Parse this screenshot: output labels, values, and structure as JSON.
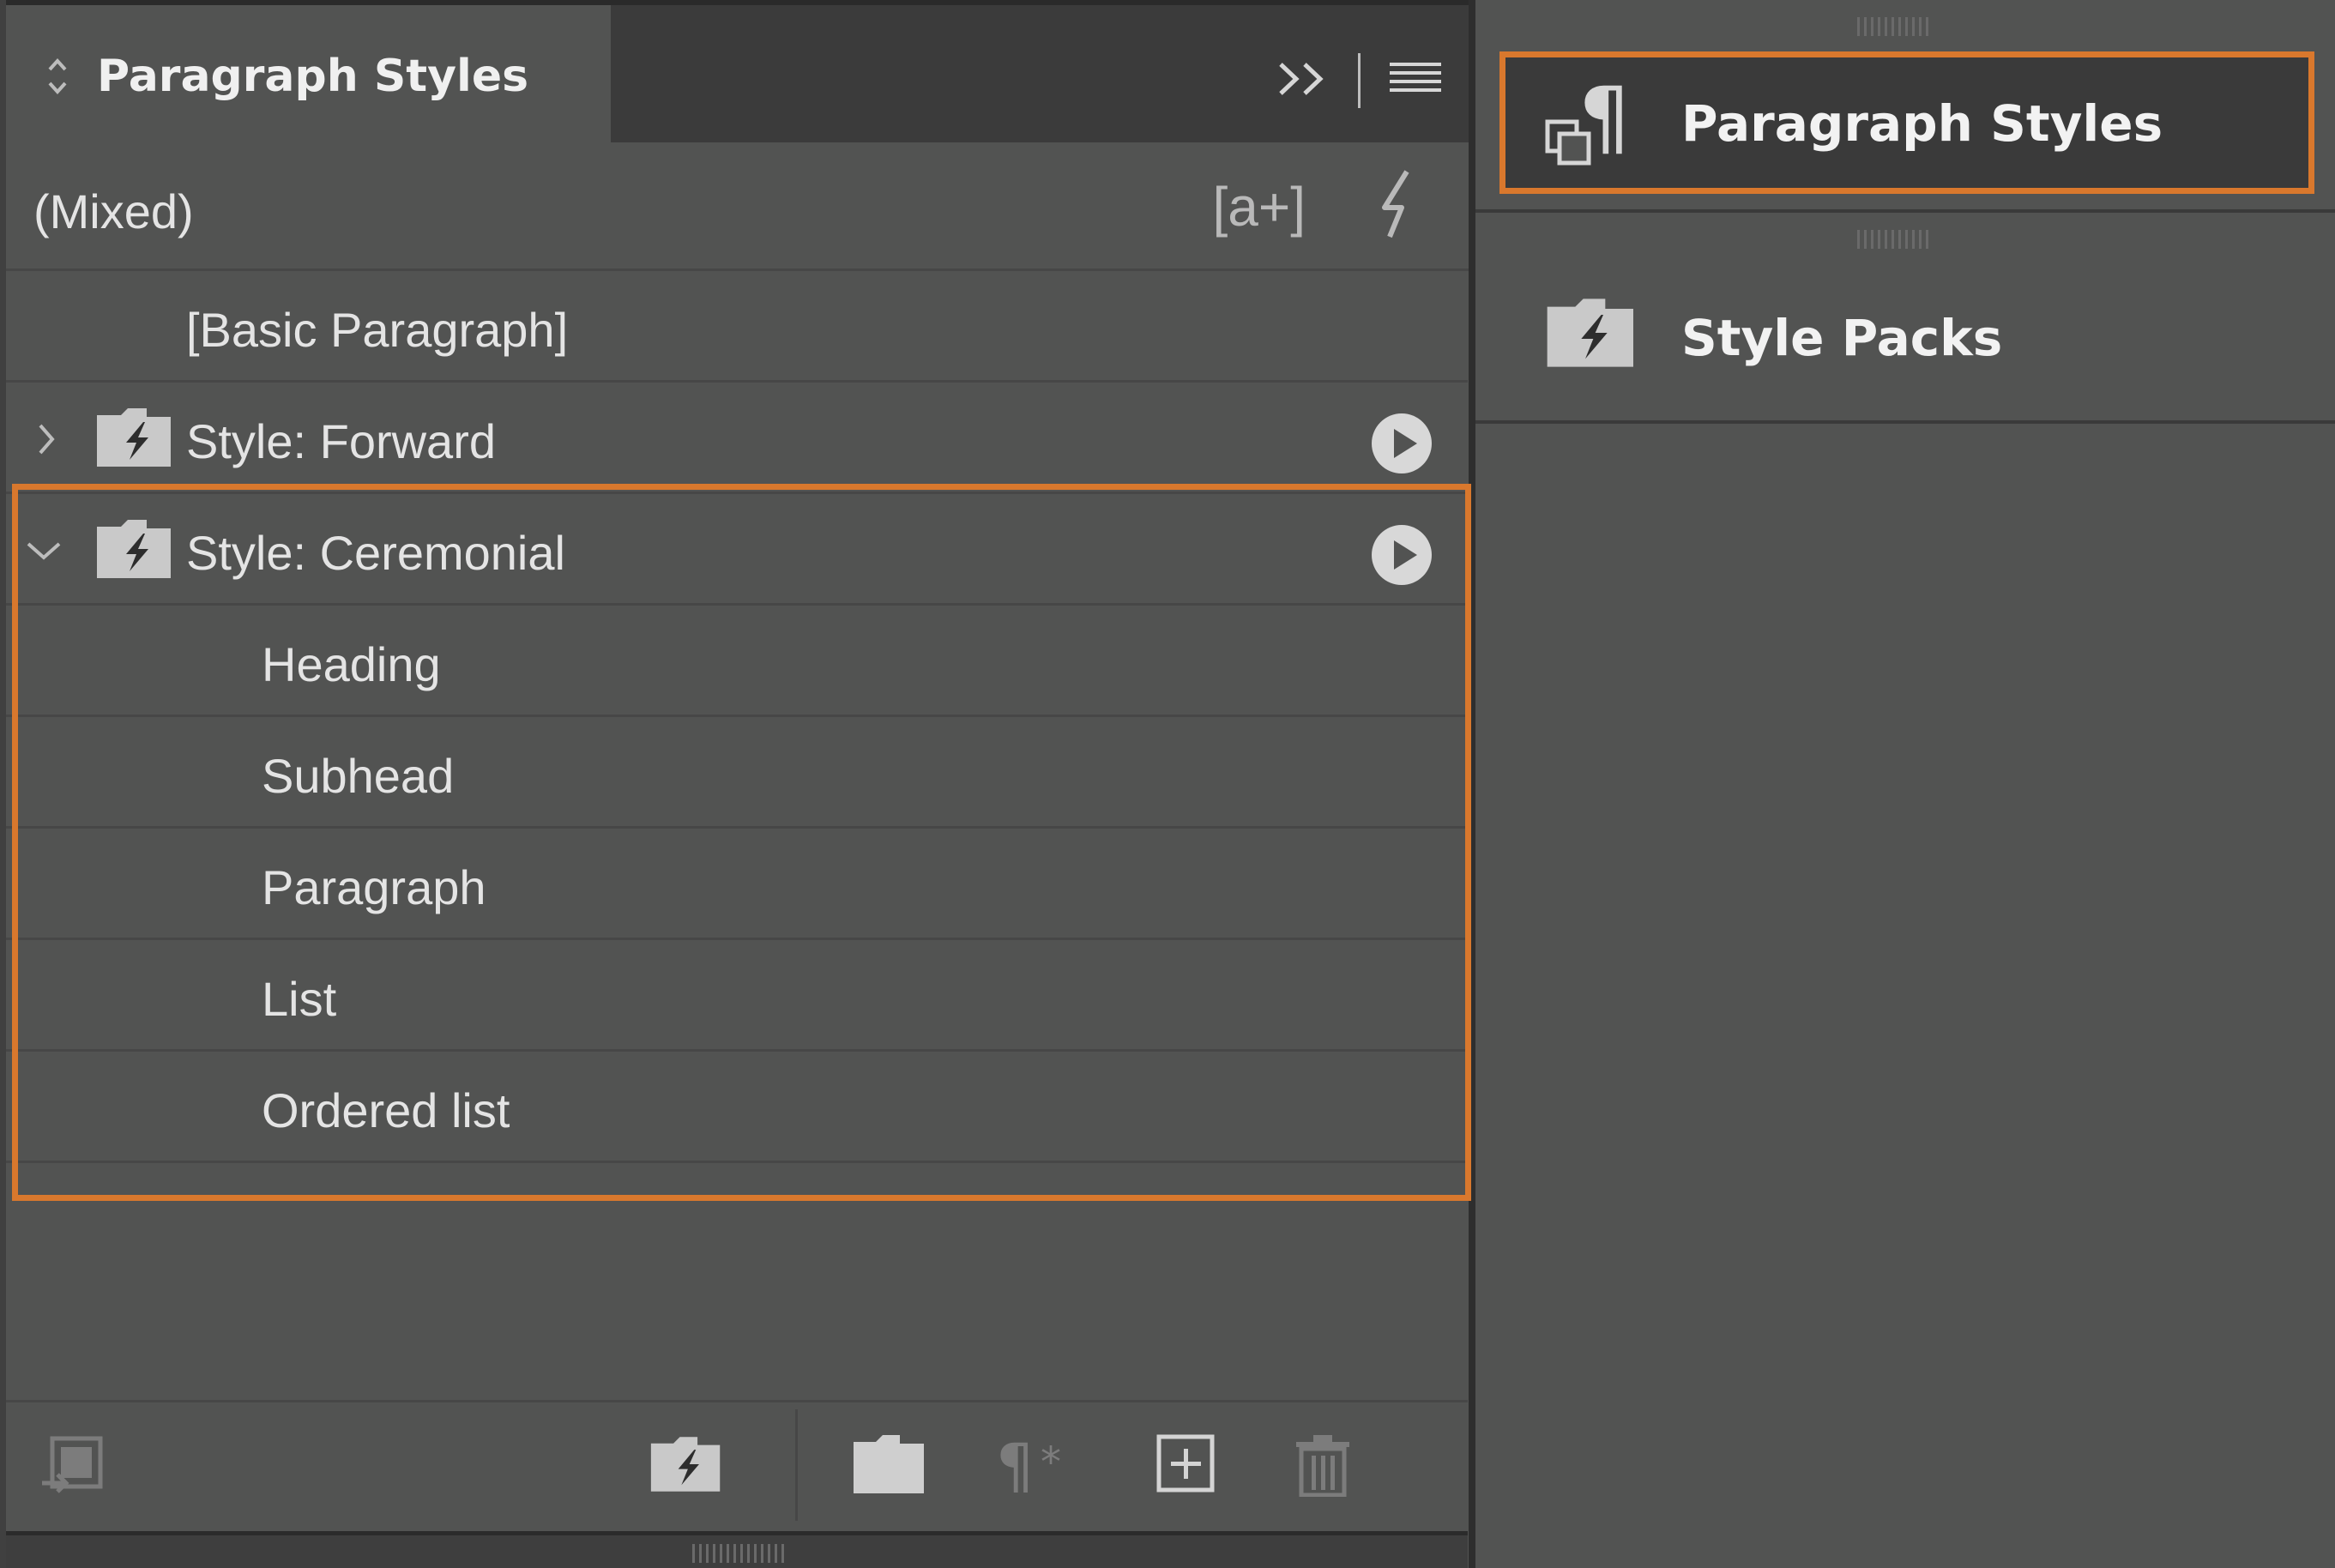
{
  "left_panel": {
    "tab_title": "Paragraph Styles",
    "current_style": "(Mixed)",
    "create_new_label": "[a+]",
    "rows": [
      {
        "label": "[Basic Paragraph]"
      },
      {
        "label": "Style: Forward",
        "expanded": false
      },
      {
        "label": "Style: Ceremonial",
        "expanded": true
      },
      {
        "label": "Heading"
      },
      {
        "label": "Subhead"
      },
      {
        "label": "Paragraph"
      },
      {
        "label": "List"
      },
      {
        "label": "Ordered list"
      }
    ],
    "bottom_icons": [
      "load-styles-icon",
      "style-pack-folder-icon",
      "new-group-folder-icon",
      "clear-overrides-icon",
      "new-style-icon",
      "delete-icon"
    ]
  },
  "right_dock": {
    "items": [
      {
        "label": "Paragraph Styles",
        "icon": "paragraph-styles-icon",
        "active": true
      },
      {
        "label": "Style Packs",
        "icon": "style-packs-icon",
        "active": false
      }
    ]
  },
  "colors": {
    "highlight": "#d9782d",
    "panel_bg": "#525352",
    "header_bg": "#3b3b3b"
  }
}
